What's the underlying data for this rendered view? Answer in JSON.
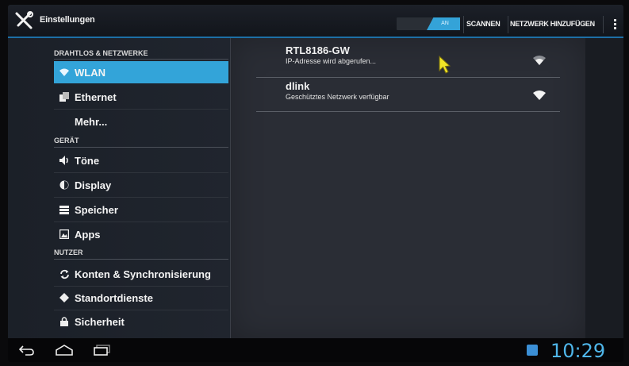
{
  "actionbar": {
    "title": "Einstellungen",
    "toggle_label": "AN",
    "scan_label": "SCANNEN",
    "add_network_label": "NETZWERK HINZUFÜGEN"
  },
  "sidebar": {
    "sections": [
      {
        "label": "DRAHTLOS & NETZWERKE"
      },
      {
        "label": "GERÄT"
      },
      {
        "label": "NUTZER"
      }
    ],
    "items": [
      {
        "label": "WLAN",
        "icon": "wifi-icon"
      },
      {
        "label": "Ethernet",
        "icon": "ethernet-icon"
      },
      {
        "label": "Mehr..."
      },
      {
        "label": "Töne",
        "icon": "speaker-icon"
      },
      {
        "label": "Display",
        "icon": "brightness-icon"
      },
      {
        "label": "Speicher",
        "icon": "storage-icon"
      },
      {
        "label": "Apps",
        "icon": "apps-icon"
      },
      {
        "label": "Konten & Synchronisierung",
        "icon": "sync-icon"
      },
      {
        "label": "Standortdienste",
        "icon": "location-icon"
      },
      {
        "label": "Sicherheit",
        "icon": "lock-icon"
      }
    ]
  },
  "networks": [
    {
      "name": "RTL8186-GW",
      "status": "IP-Adresse wird abgerufen..."
    },
    {
      "name": "dlink",
      "status": "Geschütztes Netzwerk verfügbar"
    }
  ],
  "system": {
    "clock": "10:29"
  },
  "colors": {
    "accent": "#33a4d9",
    "clock": "#4fb6ea",
    "cursor": "#f2e626"
  }
}
